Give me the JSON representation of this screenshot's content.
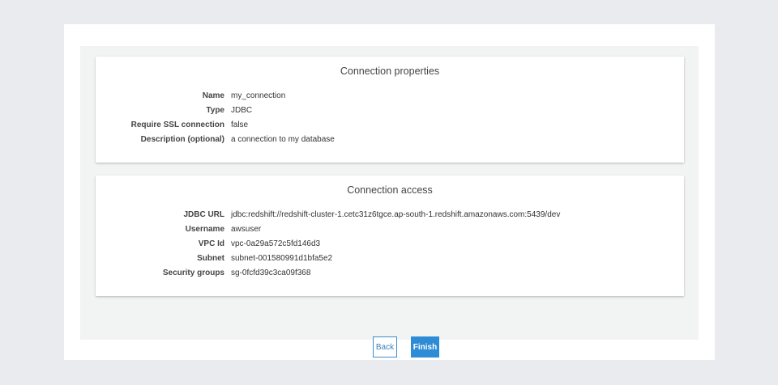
{
  "properties": {
    "title": "Connection properties",
    "rows": [
      {
        "label": "Name",
        "value": "my_connection"
      },
      {
        "label": "Type",
        "value": "JDBC"
      },
      {
        "label": "Require SSL connection",
        "value": "false"
      },
      {
        "label": "Description (optional)",
        "value": "a connection to my database"
      }
    ]
  },
  "access": {
    "title": "Connection access",
    "rows": [
      {
        "label": "JDBC URL",
        "value": "jdbc:redshift://redshift-cluster-1.cetc31z6tgce.ap-south-1.redshift.amazonaws.com:5439/dev"
      },
      {
        "label": "Username",
        "value": "awsuser"
      },
      {
        "label": "VPC Id",
        "value": "vpc-0a29a572c5fd146d3"
      },
      {
        "label": "Subnet",
        "value": "subnet-001580991d1bfa5e2"
      },
      {
        "label": "Security groups",
        "value": "sg-0fcfd39c3ca09f368"
      }
    ]
  },
  "footer": {
    "back_label": "Back",
    "finish_label": "Finish"
  },
  "colors": {
    "accent": "#2e8bd5",
    "page_bg": "#e9ebee"
  }
}
